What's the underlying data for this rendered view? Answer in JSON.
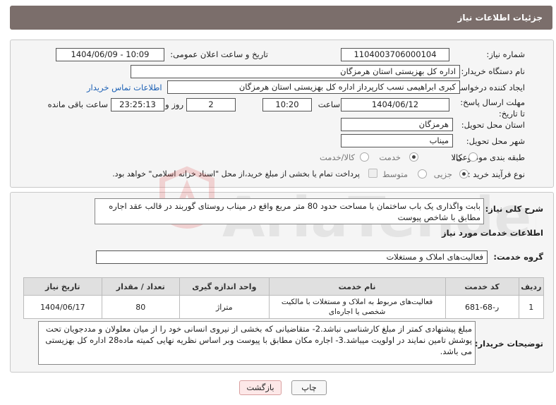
{
  "header": {
    "title": "جزئیات اطلاعات نیاز"
  },
  "form": {
    "need_number_label": "شماره نیاز:",
    "need_number": "1104003706000104",
    "announce_label": "تاریخ و ساعت اعلان عمومی:",
    "announce_value": "1404/06/09 - 10:09",
    "buyer_org_label": "نام دستگاه خریدار:",
    "buyer_org": "اداره کل بهزیستی استان هرمزگان",
    "requester_label": "ایجاد کننده درخواست:",
    "requester": "کبری  ابراهیمی نسب کارپرداز اداره کل بهزیستی استان هرمزگان",
    "buyer_contact_link": "اطلاعات تماس خریدار",
    "deadline_label": "مهلت ارسال پاسخ: تا تاریخ:",
    "deadline_date": "1404/06/12",
    "time_label": "ساعت",
    "deadline_time": "10:20",
    "days_value": "2",
    "days_label": "روز و",
    "remaining_time": "23:25:13",
    "remaining_label": "ساعت باقی مانده",
    "province_label": "استان محل تحویل:",
    "province": "هرمزگان",
    "city_label": "شهر محل تحویل:",
    "city": "میناب",
    "category_label": "طبقه بندی موضوعی:",
    "category_options": [
      "کالا",
      "خدمت",
      "کالا/خدمت"
    ],
    "category_selected": "خدمت",
    "process_label": "نوع فرآیند خرید :",
    "process_options": [
      "جزیی",
      "متوسط"
    ],
    "process_selected": "جزیی",
    "payment_note": "پرداخت تمام یا بخشی از مبلغ خرید،از محل \"اسناد خزانه اسلامی\" خواهد بود."
  },
  "summary": {
    "label": "شرح کلی نیاز:",
    "text": "بابت واگذاری یک باب ساختمان با مساحت حدود 80 متر مربع واقع در میناب روستای گوربند در قالب عقد اجاره مطابق با شاخص پیوست"
  },
  "services": {
    "section_title": "اطلاعات خدمات مورد نیاز",
    "group_label": "گروه خدمت:",
    "group_value": "فعالیت‌های  املاک و مستغلات",
    "columns": [
      "ردیف",
      "کد خدمت",
      "نام خدمت",
      "واحد اندازه گیری",
      "تعداد / مقدار",
      "تاریخ نیاز"
    ],
    "rows": [
      {
        "row": "1",
        "code": "ر-68-681",
        "name": "فعالیت‌های مربوط به املاک و مستغلات با مالکیت شخصی یا اجاره‌ای",
        "unit": "متراژ",
        "qty": "80",
        "date": "1404/06/17"
      }
    ]
  },
  "buyer_notes": {
    "label": "توضیحات خریدار:",
    "text": "مبلغ پیشنهادی کمتر از مبلغ کارشناسی نباشد.2- متقاضیانی که بخشی از نیروی انسانی خود را از میان معلولان و مددجویان تحت پوشش تامین نمایند در اولویت میباشد.3-  اجاره مکان  مطابق با پیوست وبر اساس نظریه نهایی کمیته ماده28 اداره کل بهزیستی می باشد."
  },
  "actions": {
    "print_label": "چاپ",
    "back_label": "بازگشت"
  },
  "watermark": {
    "text": "AriaTender.neT"
  }
}
